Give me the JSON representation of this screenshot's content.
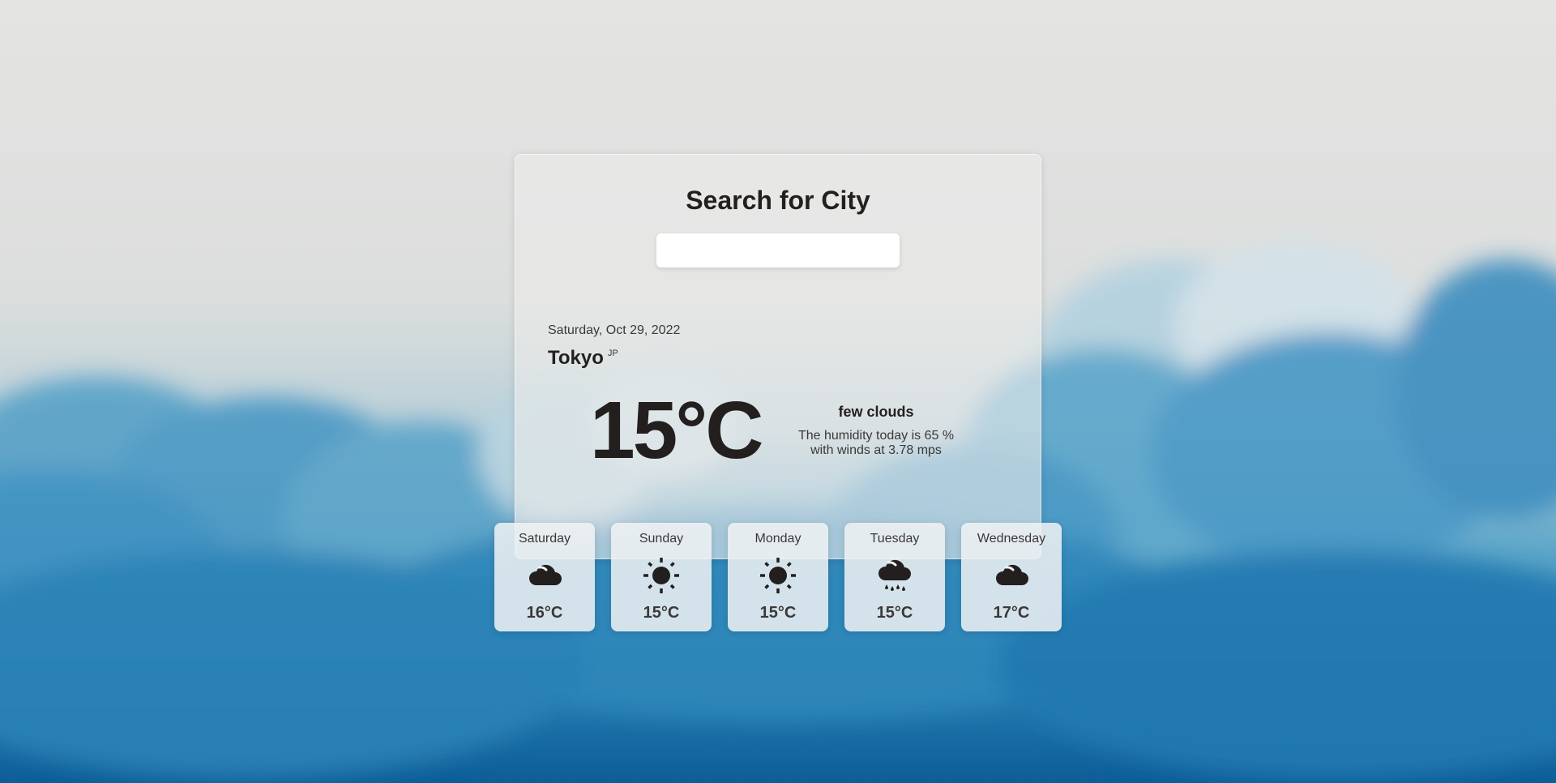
{
  "search": {
    "title": "Search for City",
    "input_value": "",
    "placeholder": ""
  },
  "current": {
    "date": "Saturday, Oct 29, 2022",
    "city": "Tokyo",
    "country": "JP",
    "temperature": "15°C",
    "condition": "few clouds",
    "humidity_text": "The humidity today is 65 %",
    "wind_text": "with winds at 3.78 mps"
  },
  "forecast": [
    {
      "day": "Saturday",
      "icon": "cloud-icon",
      "temp": "16°C"
    },
    {
      "day": "Sunday",
      "icon": "sun-icon",
      "temp": "15°C"
    },
    {
      "day": "Monday",
      "icon": "sun-icon",
      "temp": "15°C"
    },
    {
      "day": "Tuesday",
      "icon": "rain-cloud-icon",
      "temp": "15°C"
    },
    {
      "day": "Wednesday",
      "icon": "cloud-icon",
      "temp": "17°C"
    }
  ],
  "colors": {
    "text_dark": "#231f1f",
    "text_muted": "#3c3838",
    "sky_blue": "#2a86b8"
  }
}
